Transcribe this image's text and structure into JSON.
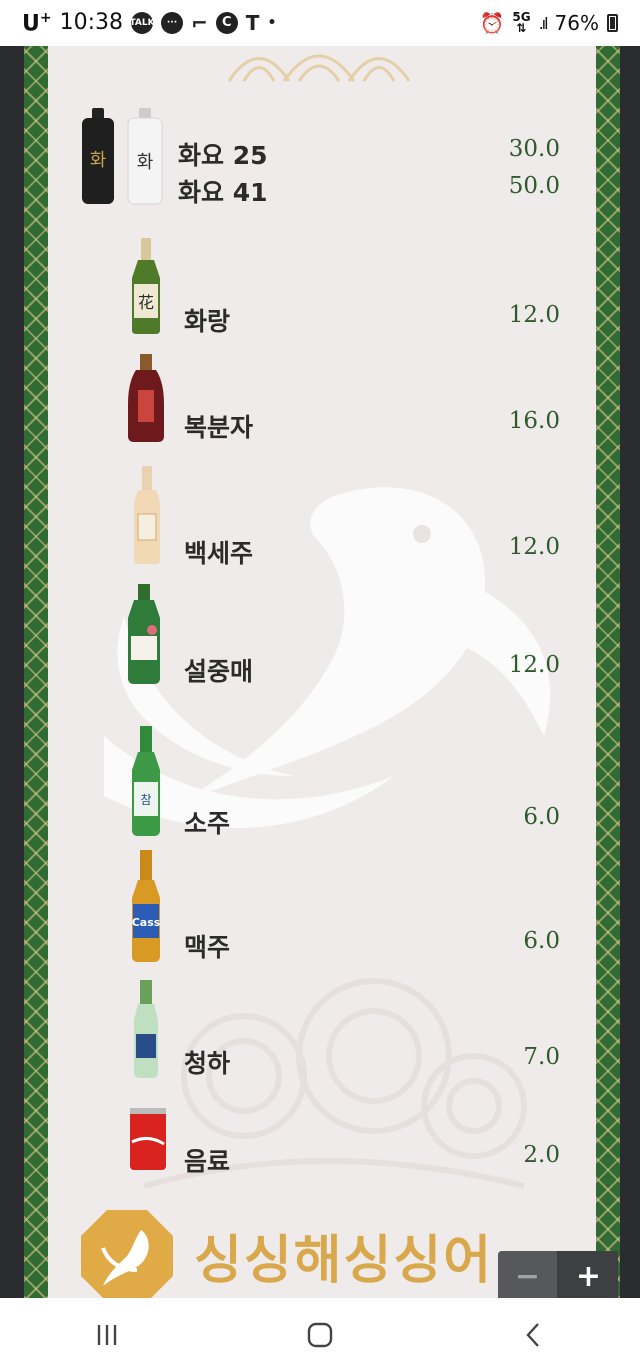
{
  "status_bar": {
    "carrier": "U",
    "carrier_sup": "+",
    "time": "10:38",
    "notif_icons": [
      "talk-icon",
      "chat-bubble-icon",
      "signal-arc-icon",
      "c-circle-icon",
      "t-icon",
      "dot-icon"
    ],
    "right_icons": [
      "alarm-icon",
      "5g-data-icon",
      "signal-bars-icon"
    ],
    "battery": "76%"
  },
  "menu": {
    "items": [
      {
        "name": "화요 25",
        "price": "30.0"
      },
      {
        "name": "화요 41",
        "price": "50.0"
      },
      {
        "name": "화랑",
        "price": "12.0"
      },
      {
        "name": "복분자",
        "price": "16.0"
      },
      {
        "name": "백세주",
        "price": "12.0"
      },
      {
        "name": "설중매",
        "price": "12.0"
      },
      {
        "name": "소주",
        "price": "6.0"
      },
      {
        "name": "맥주",
        "price": "6.0"
      },
      {
        "name": "청하",
        "price": "7.0"
      },
      {
        "name": "음료",
        "price": "2.0"
      }
    ],
    "brand_text": "싱싱해싱싱어"
  },
  "zoom": {
    "minus": "−",
    "plus": "+"
  },
  "colors": {
    "card_bg": "#efebea",
    "border_green": "#2f6b33",
    "price_green": "#2f5a2a",
    "brand_gold": "#d9a84c"
  }
}
